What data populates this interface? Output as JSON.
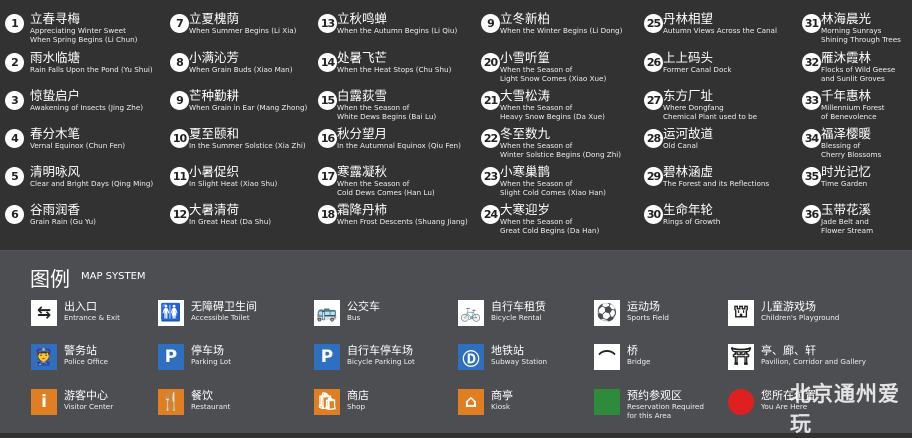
{
  "spots": [
    {
      "n": "1",
      "zh": "立春寻梅",
      "en": [
        "Appreciating Winter Sweet",
        "When Spring Begins (Li Chun)"
      ]
    },
    {
      "n": "2",
      "zh": "雨水临塘",
      "en": [
        "Rain Falls Upon the Pond (Yu Shui)"
      ]
    },
    {
      "n": "3",
      "zh": "惊蛰启户",
      "en": [
        "Awakening of Insects (Jing Zhe)"
      ]
    },
    {
      "n": "4",
      "zh": "春分木笔",
      "en": [
        "Vernal Equinox (Chun Fen)"
      ]
    },
    {
      "n": "5",
      "zh": "清明咏风",
      "en": [
        "Clear and Bright Days (Qing Ming)"
      ]
    },
    {
      "n": "6",
      "zh": "谷雨润香",
      "en": [
        "Grain Rain (Gu Yu)"
      ]
    },
    {
      "n": "7",
      "zh": "立夏槐荫",
      "en": [
        "When Summer Begins (Li Xia)"
      ]
    },
    {
      "n": "8",
      "zh": "小满沁芳",
      "en": [
        "When Grain Buds (Xiao Man)"
      ]
    },
    {
      "n": "9",
      "zh": "芒种勤耕",
      "en": [
        "When Grain in Ear (Mang Zhong)"
      ]
    },
    {
      "n": "10",
      "zh": "夏至颐和",
      "en": [
        "In the Summer Solstice (Xia Zhi)"
      ]
    },
    {
      "n": "11",
      "zh": "小暑促织",
      "en": [
        "In Slight Heat (Xiao Shu)"
      ]
    },
    {
      "n": "12",
      "zh": "大暑清荷",
      "en": [
        "In Great Heat (Da Shu)"
      ]
    },
    {
      "n": "13",
      "zh": "立秋鸣蝉",
      "en": [
        "When the Autumn Begins (Li Qiu)"
      ]
    },
    {
      "n": "14",
      "zh": "处暑飞芒",
      "en": [
        "When the Heat Stops (Chu Shu)"
      ]
    },
    {
      "n": "15",
      "zh": "白露荻雪",
      "en": [
        "When the Season of",
        "White Dews Begins (Bai Lu)"
      ]
    },
    {
      "n": "16",
      "zh": "秋分望月",
      "en": [
        "In the Autumnal Equinox (Qiu Fen)"
      ]
    },
    {
      "n": "17",
      "zh": "寒露凝秋",
      "en": [
        "When the Season of",
        "Cold Dews Comes (Han Lu)"
      ]
    },
    {
      "n": "18",
      "zh": "霜降丹柿",
      "en": [
        "When Frost Descents (Shuang Jiang)"
      ]
    },
    {
      "n": "9",
      "zh": "立冬新柏",
      "en": [
        "When the Winter Begins (Li Dong)"
      ]
    },
    {
      "n": "20",
      "zh": "小雪听篁",
      "en": [
        "When the Season of",
        "Light Snow Comes (Xiao Xue)"
      ]
    },
    {
      "n": "21",
      "zh": "大雪松涛",
      "en": [
        "When the Season of",
        "Heavy Snow Begins (Da Xue)"
      ]
    },
    {
      "n": "22",
      "zh": "冬至数九",
      "en": [
        "When the Season of",
        "Winter Solstice Begins (Dong Zhi)"
      ]
    },
    {
      "n": "23",
      "zh": "小寒巢鹊",
      "en": [
        "When the Season of",
        "Slight Cold Comes (Xiao Han)"
      ]
    },
    {
      "n": "24",
      "zh": "大寒迎岁",
      "en": [
        "When the Season of",
        "Great Cold Begins (Da Han)"
      ]
    },
    {
      "n": "25",
      "zh": "丹林相望",
      "en": [
        "Autumn Views Across the Canal"
      ]
    },
    {
      "n": "26",
      "zh": "上上码头",
      "en": [
        "Former Canal Dock"
      ]
    },
    {
      "n": "27",
      "zh": "东方厂址",
      "en": [
        "Where Dongfang",
        "Chemical Plant used to be"
      ]
    },
    {
      "n": "28",
      "zh": "运河故道",
      "en": [
        "Old Canal"
      ]
    },
    {
      "n": "29",
      "zh": "碧林涵虚",
      "en": [
        "The Forest and its Reflections"
      ]
    },
    {
      "n": "30",
      "zh": "生命年轮",
      "en": [
        "Rings of Growth"
      ]
    },
    {
      "n": "31",
      "zh": "林海晨光",
      "en": [
        "Morning Sunrays",
        "Shining Through Trees"
      ]
    },
    {
      "n": "32",
      "zh": "雁沐霞林",
      "en": [
        "Flocks of Wild Geese",
        "and Sunlit Groves"
      ]
    },
    {
      "n": "33",
      "zh": "千年惠林",
      "en": [
        "Millennium Forest",
        "of Benevolence"
      ]
    },
    {
      "n": "34",
      "zh": "福泽樱暖",
      "en": [
        "Blessing of",
        "Cherry Blossoms"
      ]
    },
    {
      "n": "35",
      "zh": "时光记忆",
      "en": [
        "Time Garden"
      ]
    },
    {
      "n": "36",
      "zh": "玉带花溪",
      "en": [
        "Jade Belt and",
        "Flower Stream"
      ]
    }
  ],
  "legend": {
    "title": "图例",
    "title_en": "MAP SYSTEM",
    "items": [
      {
        "icon": "entrance-exit-icon",
        "glyph": "⇆",
        "zh": "出入口",
        "en": [
          "Entrance & Exit"
        ],
        "bg": "#ffffff",
        "fg": "#222222"
      },
      {
        "icon": "accessible-toilet-icon",
        "glyph": "🚻",
        "zh": "无障碍卫生间",
        "en": [
          "Accessible Toilet"
        ],
        "bg": "#ffffff",
        "fg": "#222222"
      },
      {
        "icon": "bus-icon",
        "glyph": "🚌",
        "zh": "公交车",
        "en": [
          "Bus"
        ],
        "bg": "#ffffff",
        "fg": "#222222"
      },
      {
        "icon": "bicycle-icon",
        "glyph": "🚲",
        "zh": "自行车租赁",
        "en": [
          "Bicycle Rental"
        ],
        "bg": "#ffffff",
        "fg": "#222222"
      },
      {
        "icon": "sports-ball-icon",
        "glyph": "⚽",
        "zh": "运动场",
        "en": [
          "Sports Field"
        ],
        "bg": "#ffffff",
        "fg": "#222222"
      },
      {
        "icon": "playground-slide-icon",
        "glyph": "⛫",
        "zh": "儿童游戏场",
        "en": [
          "Children's Playground"
        ],
        "bg": "#ffffff",
        "fg": "#222222"
      },
      {
        "icon": "police-icon",
        "glyph": "👮",
        "zh": "警务站",
        "en": [
          "Police Office"
        ],
        "bg": "#2f6fc0",
        "fg": "#ffffff"
      },
      {
        "icon": "parking-icon",
        "glyph": "P",
        "zh": "停车场",
        "en": [
          "Parking Lot"
        ],
        "bg": "#2f6fc0",
        "fg": "#ffffff"
      },
      {
        "icon": "bicycle-parking-icon",
        "glyph": "P",
        "zh": "自行车停车场",
        "en": [
          "Bicycle Parking Lot"
        ],
        "bg": "#2f6fc0",
        "fg": "#ffffff"
      },
      {
        "icon": "subway-icon",
        "glyph": "Ⓓ",
        "zh": "地铁站",
        "en": [
          "Subway Station"
        ],
        "bg": "#2f6fc0",
        "fg": "#ffffff"
      },
      {
        "icon": "bridge-icon",
        "glyph": "⌒",
        "zh": "桥",
        "en": [
          "Bridge"
        ],
        "bg": "#ffffff",
        "fg": "#222222"
      },
      {
        "icon": "pavilion-icon",
        "glyph": "⛩",
        "zh": "亭、廊、轩",
        "en": [
          "Pavilion, Corridor and Gallery"
        ],
        "bg": "#ffffff",
        "fg": "#222222"
      },
      {
        "icon": "info-icon",
        "glyph": "i",
        "zh": "游客中心",
        "en": [
          "Visitor Center"
        ],
        "bg": "#e07f22",
        "fg": "#ffffff"
      },
      {
        "icon": "restaurant-fork-knife-icon",
        "glyph": "🍴",
        "zh": "餐饮",
        "en": [
          "Restaurant"
        ],
        "bg": "#e07f22",
        "fg": "#ffffff"
      },
      {
        "icon": "shop-bag-icon",
        "glyph": "🛍",
        "zh": "商店",
        "en": [
          "Shop"
        ],
        "bg": "#e07f22",
        "fg": "#ffffff"
      },
      {
        "icon": "kiosk-icon",
        "glyph": "⌂",
        "zh": "商亭",
        "en": [
          "Kiosk"
        ],
        "bg": "#e07f22",
        "fg": "#ffffff"
      },
      {
        "icon": "reservation-area-swatch-icon",
        "glyph": "",
        "zh": "预约参观区",
        "en": [
          "Reservation Required",
          "for this Area"
        ],
        "bg": "#2e8b3c",
        "fg": "#ffffff"
      },
      {
        "icon": "you-are-here-icon",
        "glyph": "",
        "zh": "您所在位置",
        "en": [
          "You Are Here"
        ],
        "bg": "#e02020",
        "fg": "#ffffff",
        "round": true
      }
    ]
  },
  "watermark": "北京通州爱玩"
}
